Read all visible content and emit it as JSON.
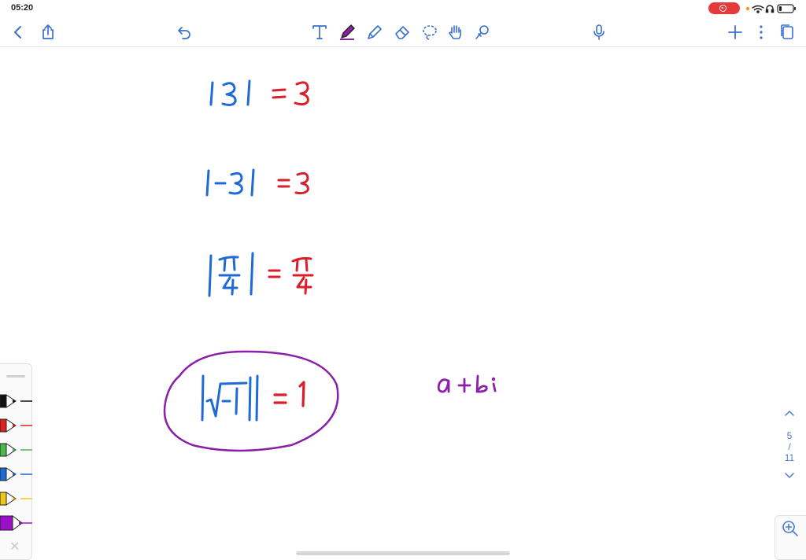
{
  "status": {
    "time": "05:20"
  },
  "toolbar": {
    "left": [
      "back-icon",
      "share-icon",
      "undo-icon"
    ],
    "tools": [
      "text-tool-icon",
      "pen-tool-icon",
      "highlighter-tool-icon",
      "eraser-tool-icon",
      "lasso-tool-icon",
      "hand-tool-icon",
      "laser-pointer-icon"
    ],
    "right": [
      "microphone-icon",
      "add-icon",
      "more-icon",
      "pages-icon"
    ]
  },
  "page_nav": {
    "current": "5",
    "separator": "/",
    "total": "11"
  },
  "colors": {
    "blue_ink": "#1f6bd6",
    "red_ink": "#d81f2a",
    "purple_ink": "#8a1fa8",
    "accent": "#4a7bd0"
  },
  "pens": [
    {
      "name": "black-pen",
      "color": "#111111"
    },
    {
      "name": "red-pen",
      "color": "#e02020"
    },
    {
      "name": "green-pen",
      "color": "#4cb84c"
    },
    {
      "name": "blue-pen",
      "color": "#1f6bd6"
    },
    {
      "name": "yellow-pen",
      "color": "#f0c818"
    },
    {
      "name": "purple-pen",
      "color": "#9a10c8",
      "selected": true
    }
  ]
}
